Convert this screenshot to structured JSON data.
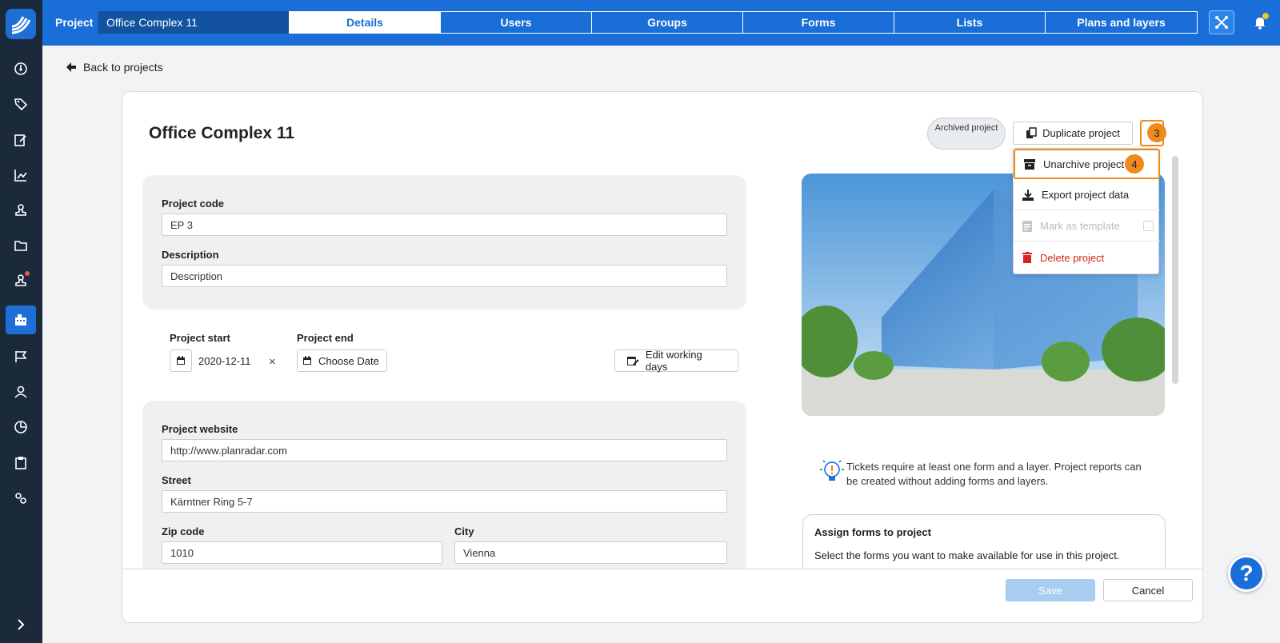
{
  "topbar": {
    "project_label": "Project",
    "project_selected": "Office Complex 11",
    "tabs": [
      {
        "label": "Details",
        "active": true
      },
      {
        "label": "Users"
      },
      {
        "label": "Groups"
      },
      {
        "label": "Forms"
      },
      {
        "label": "Lists"
      },
      {
        "label": "Plans and layers"
      }
    ]
  },
  "sidebar": {
    "items": [
      "dashboard-icon",
      "tag-icon",
      "edit-icon",
      "chart-icon",
      "stamp-icon",
      "folder-icon",
      "stamp-notification-icon",
      "building-icon",
      "flag-icon",
      "user-icon",
      "pie-chart-icon",
      "clipboard-icon",
      "settings-icon"
    ],
    "active": "building-icon",
    "expand_icon": "chevron-right-icon"
  },
  "back_link": "Back to projects",
  "project": {
    "title": "Office Complex 11",
    "archived_badge": "Archived project",
    "duplicate_label": "Duplicate project",
    "step3": "3",
    "step4": "4"
  },
  "menu": {
    "items": [
      {
        "label": "Unarchive project",
        "icon": "archive-icon"
      },
      {
        "label": "Export project data",
        "icon": "download-icon"
      },
      {
        "label": "Mark as template",
        "icon": "document-icon",
        "disabled": true
      },
      {
        "label": "Delete project",
        "icon": "trash-icon"
      }
    ]
  },
  "form": {
    "project_code_label": "Project code",
    "project_code_value": "EP 3",
    "description_label": "Description",
    "description_placeholder": "Description",
    "project_start_label": "Project start",
    "project_start_value": "2020-12-11",
    "clear_symbol": "×",
    "project_end_label": "Project end",
    "project_end_value": "Choose Date",
    "edit_working_days": "Edit working days",
    "website_label": "Project website",
    "website_value": "http://www.planradar.com",
    "street_label": "Street",
    "street_value": "Kärntner Ring 5-7",
    "zip_label": "Zip code",
    "zip_value": "1010",
    "city_label": "City",
    "city_value": "Vienna"
  },
  "tip": "Tickets require at least one form and a layer. Project reports can be created without adding forms and layers.",
  "assign": {
    "title": "Assign forms to project",
    "description": "Select the forms you want to make available for use in this project."
  },
  "footer": {
    "save_label": "Save",
    "cancel_label": "Cancel"
  },
  "help_label": "?",
  "colors": {
    "primary": "#1a6ed8",
    "sidebar": "#1b2a3a",
    "highlight": "#f08a1c",
    "danger": "#d2261f"
  }
}
